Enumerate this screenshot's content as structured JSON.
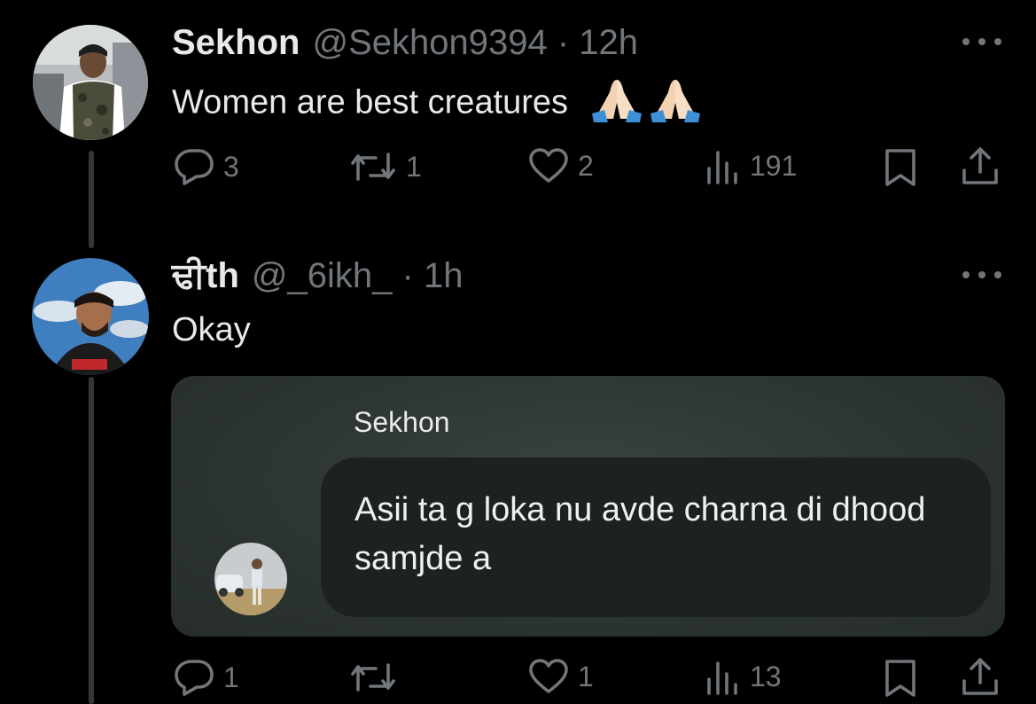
{
  "thread": {
    "tweets": [
      {
        "display_name": "Sekhon",
        "meta": "@Sekhon9394 · 12h",
        "text": "Women are best creatures",
        "emojis": [
          "folded-hands",
          "folded-hands"
        ],
        "actions": {
          "replies": "3",
          "retweets": "1",
          "likes": "2",
          "views": "191"
        }
      },
      {
        "display_name": "ਢੀth",
        "meta": "@_6ikh_ · 1h",
        "text": "Okay",
        "quote": {
          "author": "Sekhon",
          "message": "Asii ta g loka nu avde charna di dhood samjde a"
        },
        "actions": {
          "replies": "1",
          "retweets": "",
          "likes": "1",
          "views": "13"
        }
      }
    ]
  },
  "colors": {
    "background": "#000000",
    "primary_text": "#e7e9ea",
    "secondary_text": "#71767b",
    "quote_card": "#2c3431",
    "quote_bubble": "#1d2220"
  },
  "icons": [
    "more-icon",
    "reply-icon",
    "retweet-icon",
    "like-icon",
    "views-icon",
    "bookmark-icon",
    "share-icon"
  ]
}
